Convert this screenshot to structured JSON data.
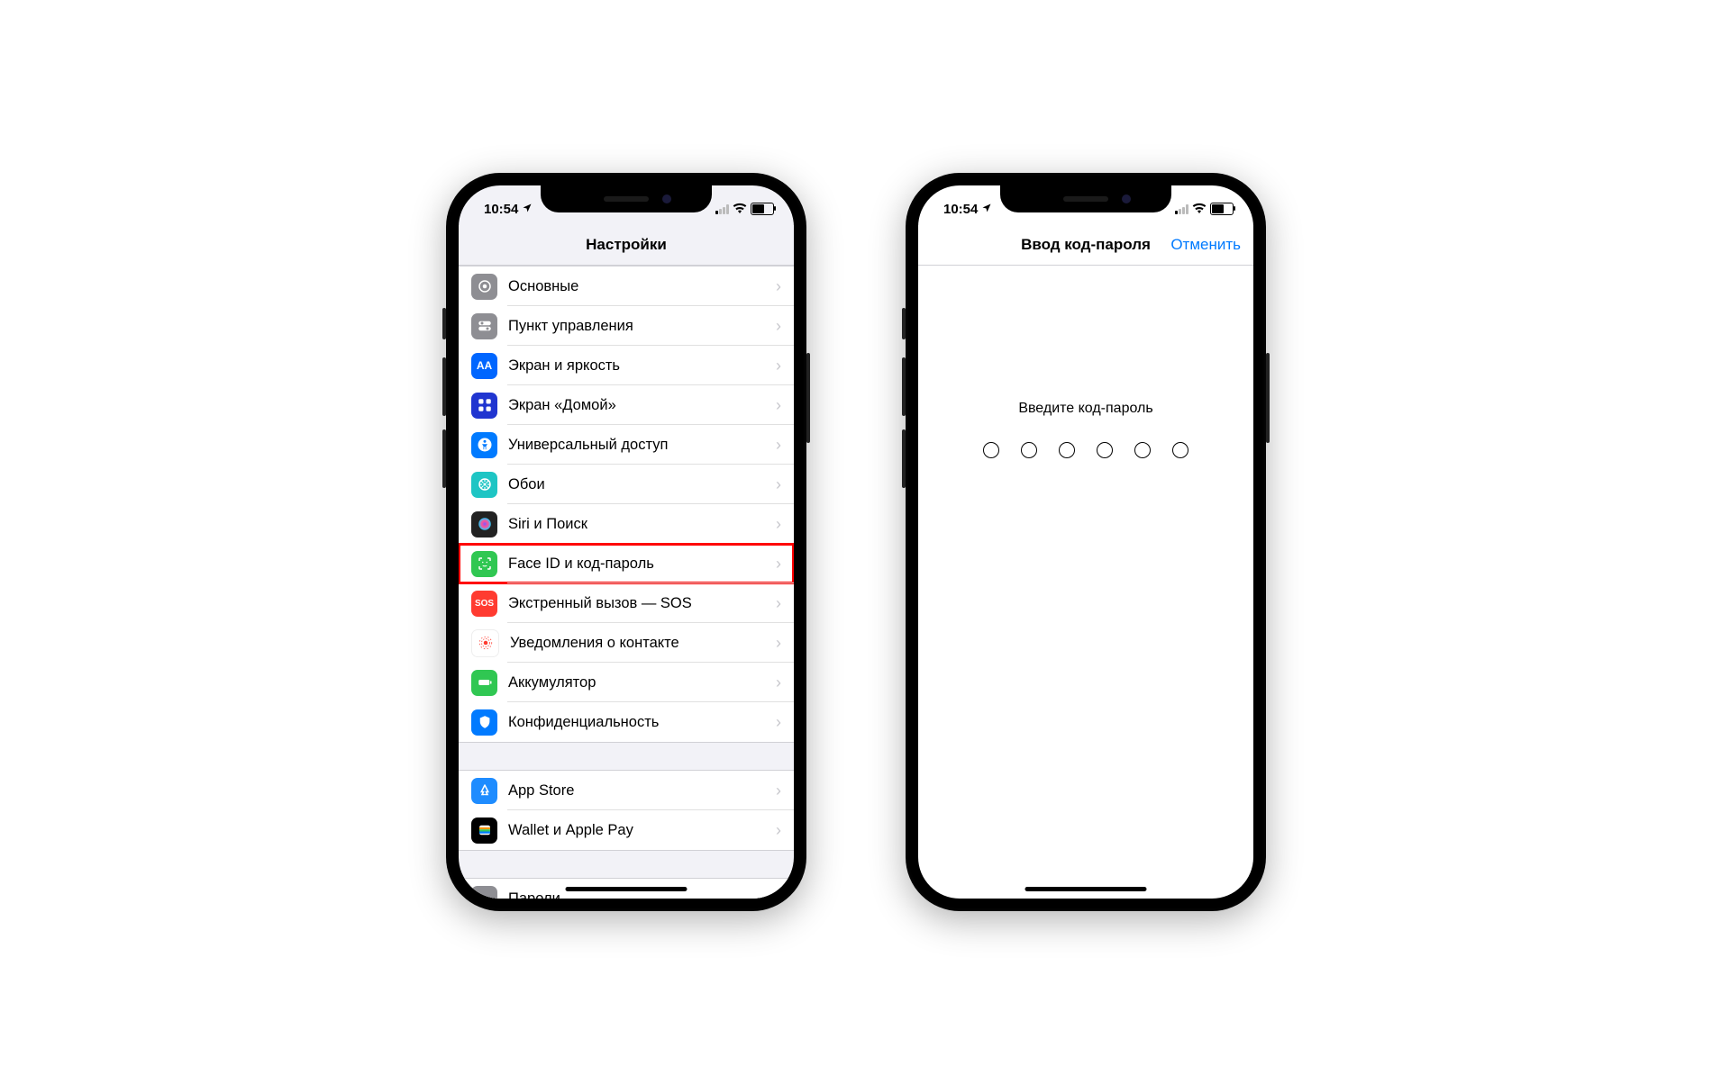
{
  "status": {
    "time": "10:54"
  },
  "phone1": {
    "nav_title": "Настройки",
    "rows_group1": [
      {
        "label": "Основные",
        "icon": "general"
      },
      {
        "label": "Пункт управления",
        "icon": "control"
      },
      {
        "label": "Экран и яркость",
        "icon": "display"
      },
      {
        "label": "Экран «Домой»",
        "icon": "home"
      },
      {
        "label": "Универсальный доступ",
        "icon": "access"
      },
      {
        "label": "Обои",
        "icon": "wallpaper"
      },
      {
        "label": "Siri и Поиск",
        "icon": "siri"
      },
      {
        "label": "Face ID и код-пароль",
        "icon": "faceid",
        "highlight": true
      },
      {
        "label": "Экстренный вызов — SOS",
        "icon": "sos"
      },
      {
        "label": "Уведомления о контакте",
        "icon": "exposure"
      },
      {
        "label": "Аккумулятор",
        "icon": "battery"
      },
      {
        "label": "Конфиденциальность",
        "icon": "privacy"
      }
    ],
    "rows_group2": [
      {
        "label": "App Store",
        "icon": "appstore"
      },
      {
        "label": "Wallet и Apple Pay",
        "icon": "wallet"
      }
    ],
    "rows_group3": [
      {
        "label": "Пароли",
        "icon": "passwords"
      }
    ]
  },
  "phone2": {
    "nav_title": "Ввод код-пароля",
    "cancel": "Отменить",
    "prompt": "Введите код-пароль",
    "digits": 6
  }
}
